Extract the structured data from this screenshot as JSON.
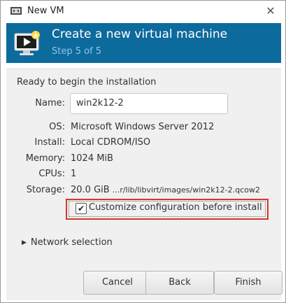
{
  "window": {
    "title": "New VM",
    "close_glyph": "✕"
  },
  "banner": {
    "title": "Create a new virtual machine",
    "step": "Step 5 of 5",
    "color": "#0d6a9c"
  },
  "summary": {
    "heading": "Ready to begin the installation",
    "name_label": "Name:",
    "name_value": "win2k12-2",
    "os_label": "OS:",
    "os_value": "Microsoft Windows Server 2012",
    "install_label": "Install:",
    "install_value": "Local CDROM/ISO",
    "memory_label": "Memory:",
    "memory_value": "1024 MiB",
    "cpus_label": "CPUs:",
    "cpus_value": "1",
    "storage_label": "Storage:",
    "storage_size": "20.0 GiB",
    "storage_path": "...r/lib/libvirt/images/win2k12-2.qcow2"
  },
  "customize": {
    "checked": true,
    "check_glyph": "✔",
    "label": "Customize configuration before install",
    "highlight_color": "#d9342b"
  },
  "network": {
    "label": "Network selection",
    "expander_glyph": "▶"
  },
  "buttons": {
    "cancel": "Cancel",
    "back": "Back",
    "finish": "Finish"
  }
}
